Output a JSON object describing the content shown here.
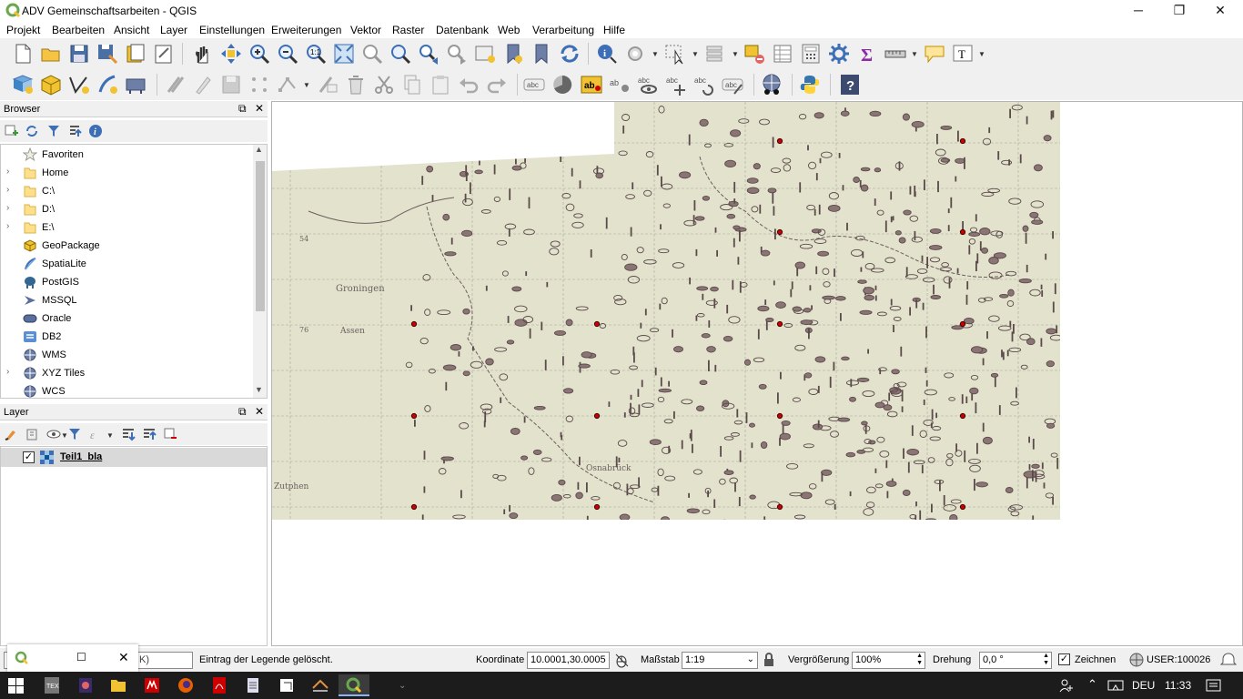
{
  "window": {
    "title": "ADV Gemeinschaftsarbeiten - QGIS",
    "minimize": "─",
    "maximize": "❐",
    "close": "✕"
  },
  "menu": [
    "Projekt",
    "Bearbeiten",
    "Ansicht",
    "Layer",
    "Einstellungen",
    "Erweiterungen",
    "Vektor",
    "Raster",
    "Datenbank",
    "Web",
    "Verarbeitung",
    "Hilfe"
  ],
  "browser": {
    "title": "Browser",
    "items": [
      {
        "label": "Favoriten",
        "icon": "star-icon",
        "expandable": false
      },
      {
        "label": "Home",
        "icon": "folder-icon",
        "expandable": true
      },
      {
        "label": "C:\\",
        "icon": "folder-icon",
        "expandable": true
      },
      {
        "label": "D:\\",
        "icon": "folder-icon",
        "expandable": true
      },
      {
        "label": "E:\\",
        "icon": "folder-icon",
        "expandable": true
      },
      {
        "label": "GeoPackage",
        "icon": "geopackage-icon",
        "expandable": false
      },
      {
        "label": "SpatiaLite",
        "icon": "spatialite-icon",
        "expandable": false
      },
      {
        "label": "PostGIS",
        "icon": "postgis-icon",
        "expandable": false
      },
      {
        "label": "MSSQL",
        "icon": "mssql-icon",
        "expandable": false
      },
      {
        "label": "Oracle",
        "icon": "oracle-icon",
        "expandable": false
      },
      {
        "label": "DB2",
        "icon": "db2-icon",
        "expandable": false
      },
      {
        "label": "WMS",
        "icon": "wms-icon",
        "expandable": false
      },
      {
        "label": "XYZ Tiles",
        "icon": "xyz-tiles-icon",
        "expandable": true
      },
      {
        "label": "WCS",
        "icon": "wcs-icon",
        "expandable": false
      }
    ]
  },
  "layers": {
    "title": "Layer",
    "items": [
      {
        "label": "Teil1_bla",
        "checked": true
      }
    ]
  },
  "map": {
    "labels": [
      "Groningen",
      "Assen",
      "Zutphen",
      "Osnabrück",
      "54",
      "76"
    ],
    "colors": {
      "paper": "#e4e3cf",
      "ink": "#5a4a4a",
      "grid_point": "#cc0000"
    }
  },
  "status": {
    "search_placeholder": "K)",
    "message": "Eintrag der Legende gelöscht.",
    "coord_label": "Koordinate",
    "coord_value": "10.0001,30.0005",
    "scale_label": "Maßstab",
    "scale_value": "1:19",
    "magnify_label": "Vergrößerung",
    "magnify_value": "100%",
    "rotation_label": "Drehung",
    "rotation_value": "0,0 °",
    "render_label": "Zeichnen",
    "crs_label": "USER:100026"
  },
  "taskbar": {
    "lang": "DEU",
    "time": "11:33"
  }
}
